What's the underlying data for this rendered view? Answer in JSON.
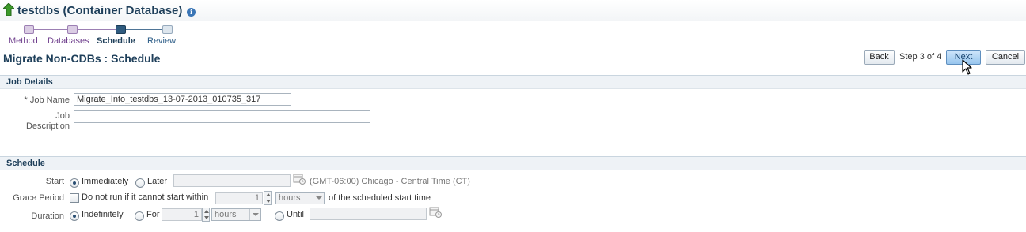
{
  "header": {
    "title": "testdbs (Container Database)",
    "info_icon": "info-icon",
    "home_icon": "up-arrow-icon"
  },
  "train": {
    "steps": [
      {
        "label": "Method",
        "state": "done"
      },
      {
        "label": "Databases",
        "state": "done"
      },
      {
        "label": "Schedule",
        "state": "current"
      },
      {
        "label": "Review",
        "state": "next"
      }
    ]
  },
  "page": {
    "subtitle": "Migrate Non-CDBs : Schedule"
  },
  "toolbar": {
    "back_label": "Back",
    "step_text": "Step 3 of 4",
    "next_label": "Next",
    "cancel_label": "Cancel"
  },
  "job_details": {
    "section_title": "Job Details",
    "job_name_label": "* Job Name",
    "job_name_value": "Migrate_Into_testdbs_13-07-2013_010735_317",
    "job_desc_label_1": "Job",
    "job_desc_label_2": "Description",
    "job_desc_value": ""
  },
  "schedule": {
    "section_title": "Schedule",
    "start_label": "Start",
    "start_immediately": "Immediately",
    "start_later": "Later",
    "timezone_text": "(GMT-06:00) Chicago - Central Time (CT)",
    "grace_label": "Grace Period",
    "grace_check_text": "Do not run if it cannot start within",
    "grace_value": "1",
    "grace_unit": "hours",
    "grace_suffix": "of the scheduled start time",
    "duration_label": "Duration",
    "duration_indefinitely": "Indefinitely",
    "duration_for": "For",
    "duration_value": "1",
    "duration_unit": "hours",
    "duration_until": "Until"
  },
  "colors": {
    "accent": "#1e3f5a",
    "visited_step": "#6e3e8c",
    "primary_button": "#97c5ee"
  }
}
